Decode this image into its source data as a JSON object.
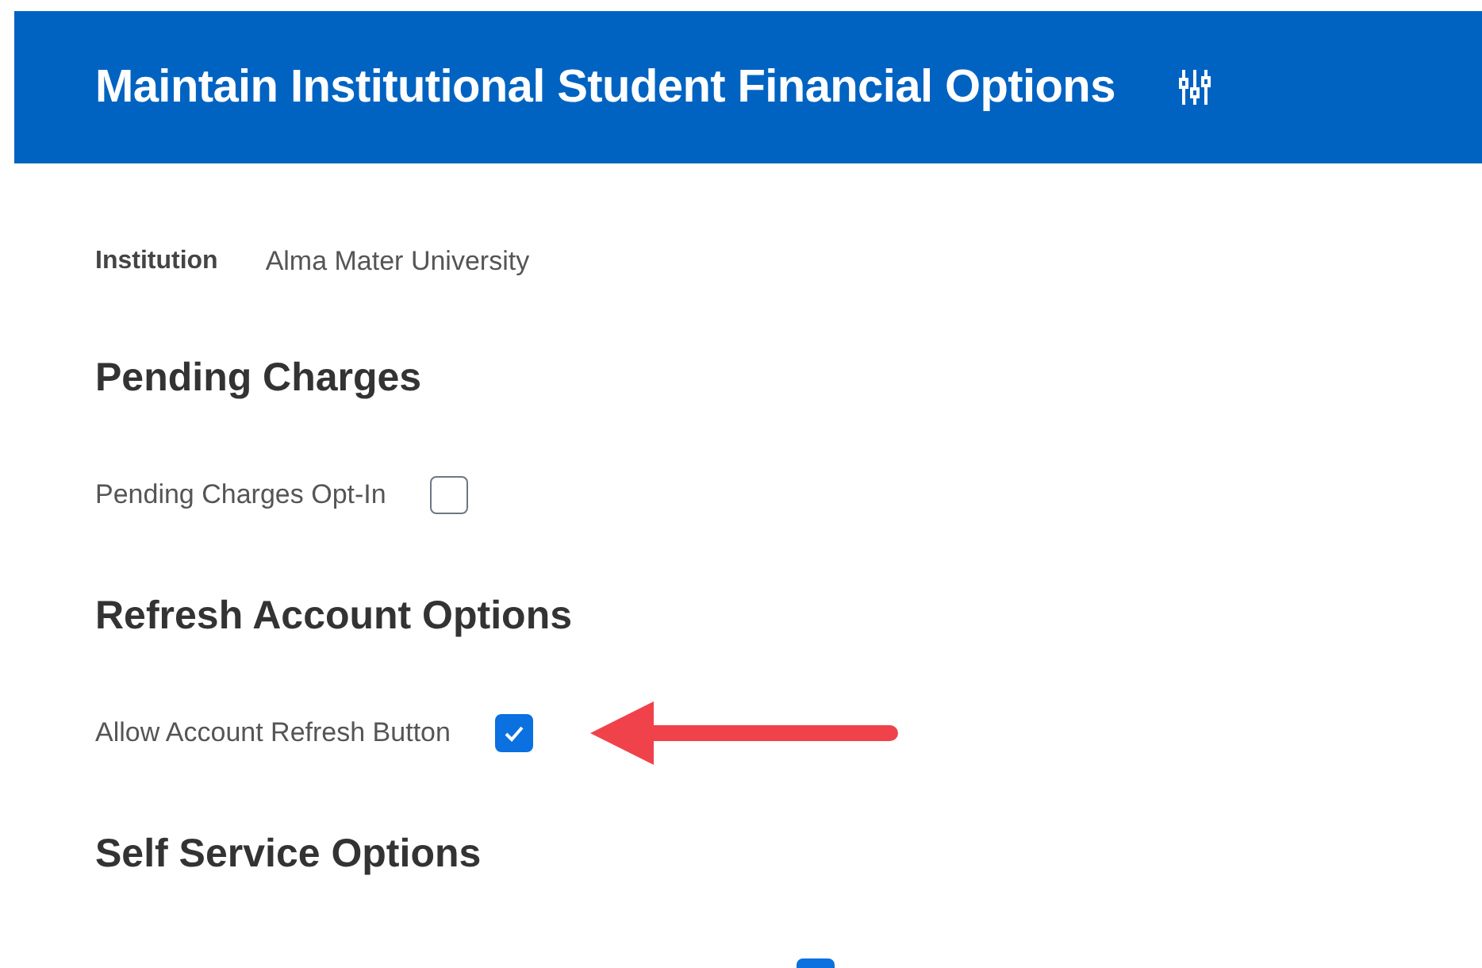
{
  "header": {
    "title": "Maintain Institutional Student Financial Options"
  },
  "institution": {
    "label": "Institution",
    "value": "Alma Mater University"
  },
  "sections": [
    {
      "heading": "Pending Charges",
      "fields": [
        {
          "label": "Pending Charges Opt-In",
          "checked": false,
          "annotated": false
        }
      ]
    },
    {
      "heading": "Refresh Account Options",
      "fields": [
        {
          "label": "Allow Account Refresh Button",
          "checked": true,
          "annotated": true
        }
      ]
    },
    {
      "heading": "Self Service Options",
      "fields": [
        {
          "checked": true,
          "annotated": false
        }
      ]
    }
  ]
}
